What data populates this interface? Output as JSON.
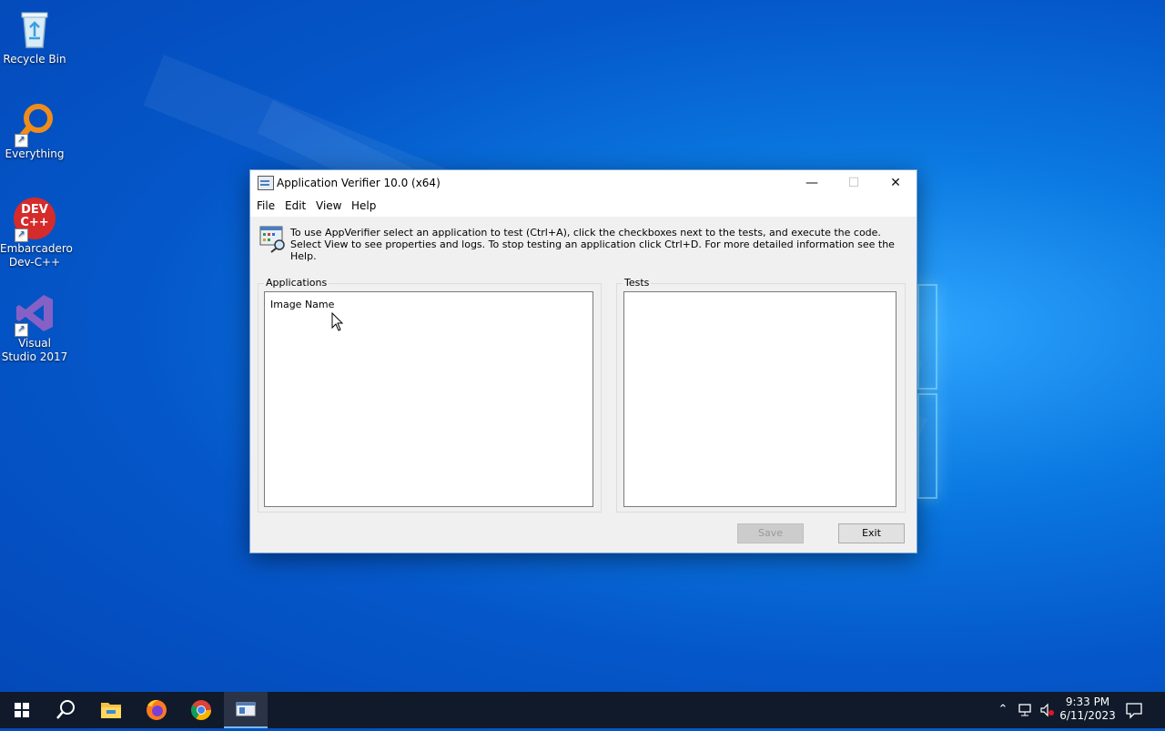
{
  "desktop": {
    "icons": [
      {
        "label": "Recycle Bin",
        "icon": "recycle-bin-icon"
      },
      {
        "label": "Everything",
        "icon": "everything-search-icon"
      },
      {
        "label": "Embarcadero Dev-C++",
        "icon": "devcpp-icon",
        "glyph_text": "DEV C++"
      },
      {
        "label": "Visual Studio 2017",
        "icon": "visual-studio-icon"
      }
    ]
  },
  "window": {
    "title": "Application Verifier 10.0 (x64)",
    "controls": {
      "minimize": "—",
      "maximize": "☐",
      "close": "✕"
    },
    "menu": [
      "File",
      "Edit",
      "View",
      "Help"
    ],
    "info_text": "To use AppVerifier select an application to test (Ctrl+A), click the checkboxes next to the tests, and execute the code. Select View to see properties and logs. To stop testing an application click Ctrl+D. For more detailed information see the Help.",
    "applications_group": {
      "label": "Applications",
      "column_header": "Image Name"
    },
    "tests_group": {
      "label": "Tests"
    },
    "buttons": {
      "save": "Save",
      "exit": "Exit"
    }
  },
  "taskbar": {
    "items": [
      "start-icon",
      "search-icon",
      "file-explorer-icon",
      "firefox-icon",
      "chrome-icon",
      "app-verifier-icon"
    ],
    "active": "app-verifier-icon",
    "clock": {
      "time": "9:33 PM",
      "date": "6/11/2023"
    },
    "colors": {
      "background": "#101a2a",
      "active_indicator": "#76b9ed"
    }
  }
}
